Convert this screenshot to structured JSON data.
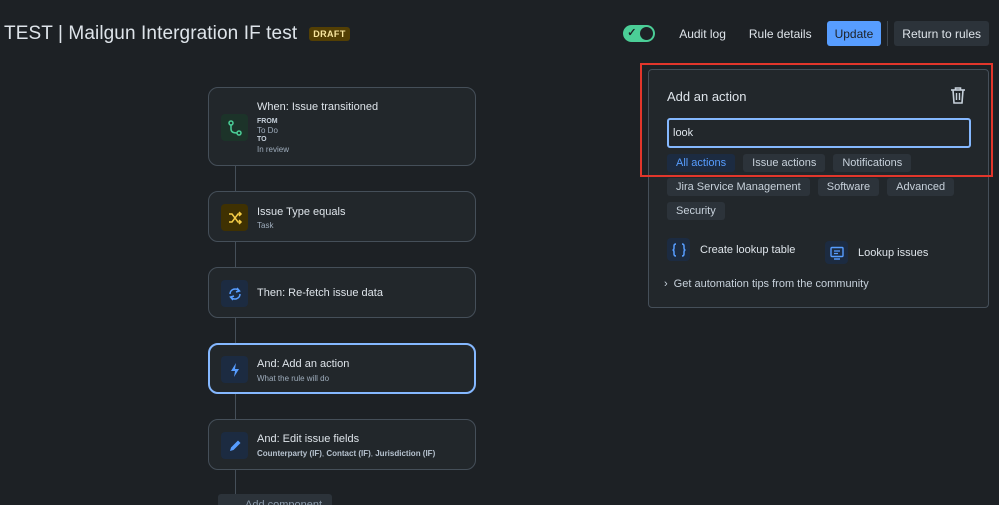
{
  "header": {
    "title": "TEST | Mailgun Intergration IF test",
    "badge": "DRAFT",
    "audit_log": "Audit log",
    "rule_details": "Rule details",
    "update": "Update",
    "return_to_rules": "Return to rules",
    "rule_enabled": true
  },
  "flow": {
    "nodes": [
      {
        "title": "When: Issue transitioned",
        "from_label": "FROM",
        "from_value": "To Do",
        "to_label": "TO",
        "to_value": "In review",
        "icon": "branch-icon"
      },
      {
        "title": "Issue Type equals",
        "subtitle": "Task",
        "icon": "shuffle-icon"
      },
      {
        "title": "Then: Re-fetch issue data",
        "icon": "refresh-icon"
      },
      {
        "title": "And: Add an action",
        "subtitle": "What the rule will do",
        "icon": "lightning-icon"
      },
      {
        "title": "And: Edit issue fields",
        "fields": [
          "Counterparty (IF)",
          "Contact (IF)",
          "Jurisdiction (IF)"
        ],
        "icon": "pencil-icon"
      }
    ],
    "add_component": "Add component"
  },
  "panel": {
    "title": "Add an action",
    "search_value": "look",
    "categories": [
      "All actions",
      "Issue actions",
      "Notifications",
      "Jira Service Management",
      "Software",
      "Advanced",
      "Security"
    ],
    "active_category": "All actions",
    "results": [
      {
        "label": "Create lookup table",
        "icon": "braces-icon"
      },
      {
        "label": "Lookup issues",
        "icon": "screen-search-icon"
      }
    ],
    "tips_label": "Get automation tips from the community"
  },
  "colors": {
    "background": "#1d2125",
    "accent": "#579dff",
    "toggle_on": "#4bce97",
    "highlight_annotation": "#e2362b"
  }
}
